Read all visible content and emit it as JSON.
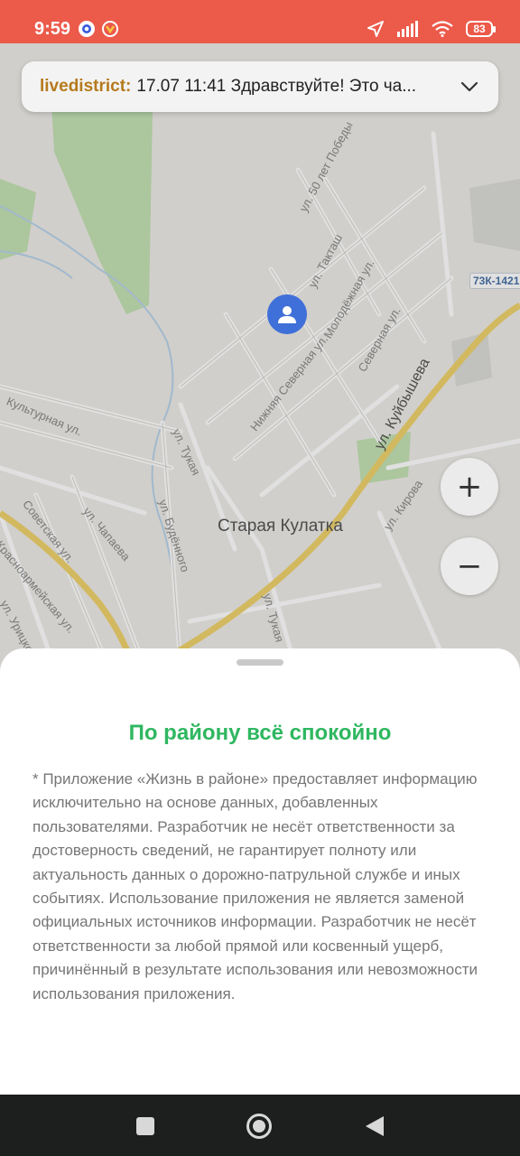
{
  "status_bar": {
    "time": "9:59",
    "battery": "83",
    "icons": [
      "messenger-icon",
      "app-notification-icon",
      "location-arrow-icon",
      "signal-icon",
      "wifi-icon",
      "battery-icon"
    ]
  },
  "banner": {
    "sender": "livedistrict:",
    "message": "17.07 11:41 Здравствуйте! Это ча..."
  },
  "map": {
    "place_name": "Старая Кулатка",
    "route_badge": "73К-1421",
    "streets": [
      "ул. 50 лет Победы",
      "ул. Такташ",
      "Молодёжная ул.",
      "Северная ул.",
      "ул. Куйбышева",
      "Нижняя Северная ул.",
      "Культурная ул.",
      "ул. Тукая",
      "ул. Будённого",
      "ул. Чапаева",
      "Советская ул.",
      "Красноармейская ул.",
      "ул. Урицкого",
      "ул. Кирова",
      "ул. Тукая"
    ],
    "zoom_in_label": "+",
    "zoom_out_label": "−"
  },
  "sheet": {
    "title": "По району всё спокойно",
    "disclaimer": "* Приложение «Жизнь в районе» предоставляет информацию исключительно на основе данных, добавленных пользователями. Разработчик не несёт ответственности за достоверность сведений, не гарантирует полноту или актуальность данных о дорожно-патрульной службе и иных событиях. Использование приложения не является заменой официальных источников информации. Разработчик не несёт ответственности за любой прямой или косвенный ущерб, причинённый в результате использования или невозможности использования приложения."
  },
  "colors": {
    "status_bar": "#ec5a4a",
    "title_green": "#2fb760",
    "sender_orange": "#b57a1c",
    "marker_blue": "#3f6fd8",
    "road_yellow": "#efd36e",
    "park_green": "#bfe0b0"
  }
}
